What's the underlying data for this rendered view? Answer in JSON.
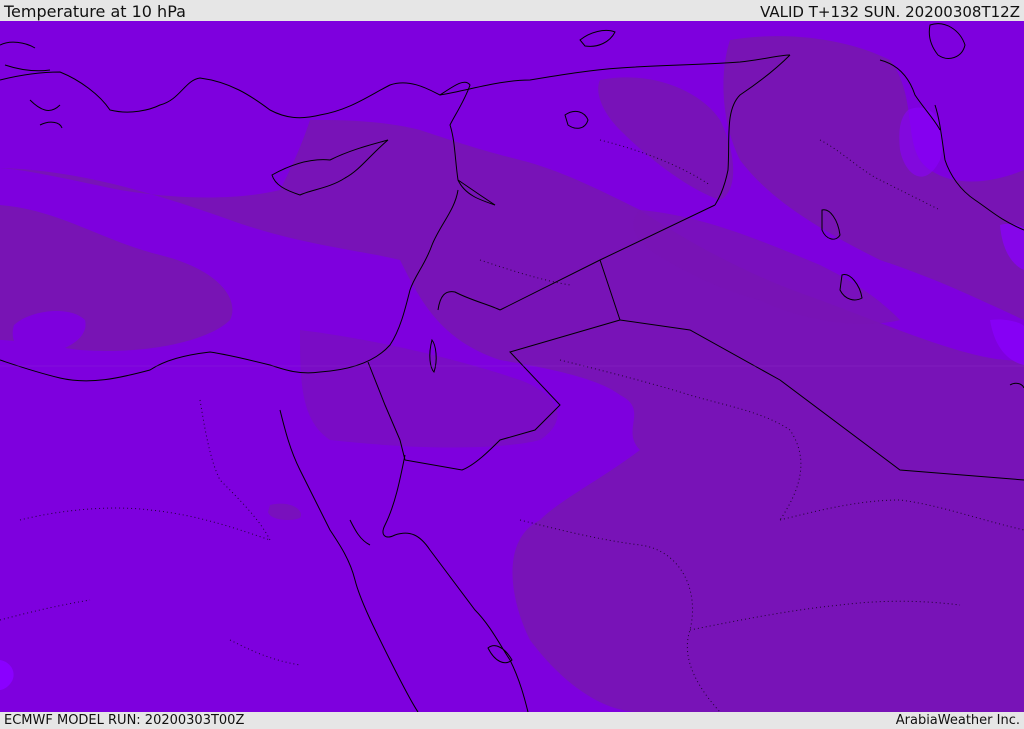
{
  "header": {
    "title": "Temperature at 10 hPa",
    "valid": "VALID T+132 SUN. 20200308T12Z"
  },
  "footer": {
    "model_run": "ECMWF MODEL RUN: 20200303T00Z",
    "credit": "ArabiaWeather Inc."
  },
  "map": {
    "region": "Eastern Mediterranean / Middle East",
    "colors": {
      "field_light": "#7e00de",
      "field_dark": "#7814b4",
      "field_accent": "#8a00ff",
      "coastline": "#000000"
    }
  }
}
